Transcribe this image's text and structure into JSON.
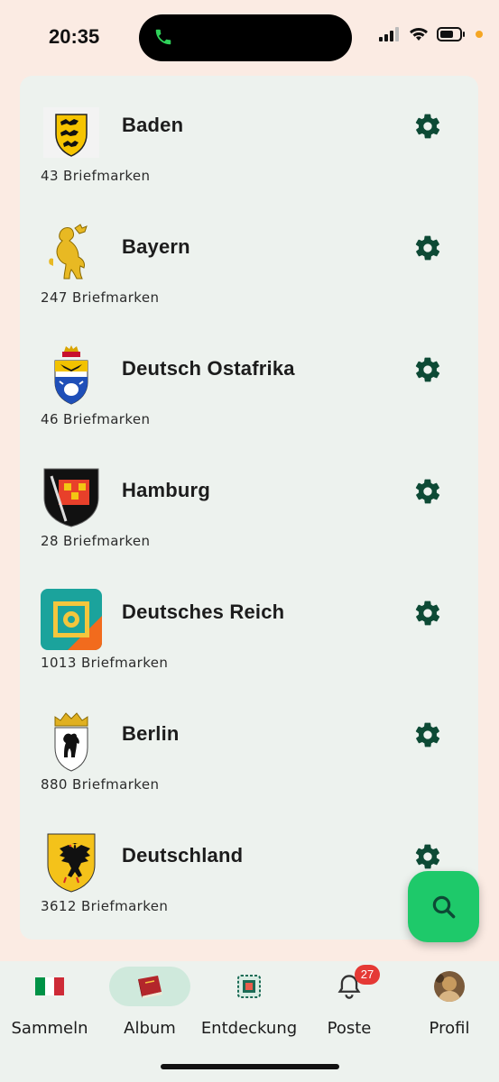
{
  "status_bar": {
    "time": "20:35"
  },
  "albums": [
    {
      "name": "Baden",
      "count": "43 Briefmarken",
      "crest": "baden-coat-of-arms-icon"
    },
    {
      "name": "Bayern",
      "count": "247 Briefmarken",
      "crest": "bavaria-lion-icon"
    },
    {
      "name": "Deutsch Ostafrika",
      "count": "46 Briefmarken",
      "crest": "east-africa-coat-of-arms-icon"
    },
    {
      "name": "Hamburg",
      "count": "28 Briefmarken",
      "crest": "hamburg-coat-of-arms-icon"
    },
    {
      "name": "Deutsches Reich",
      "count": "1013 Briefmarken",
      "crest": "stamp-icon"
    },
    {
      "name": "Berlin",
      "count": "880 Briefmarken",
      "crest": "berlin-bear-icon"
    },
    {
      "name": "Deutschland",
      "count": "3612 Briefmarken",
      "crest": "german-eagle-icon"
    }
  ],
  "nav": {
    "items": [
      {
        "label": "Sammeln",
        "icon": "italy-flag-icon"
      },
      {
        "label": "Album",
        "icon": "book-icon",
        "active": true
      },
      {
        "label": "Entdeckung",
        "icon": "stamp-frame-icon"
      },
      {
        "label": "Poste",
        "icon": "bell-icon",
        "badge": "27"
      },
      {
        "label": "Profil",
        "icon": "avatar"
      }
    ]
  },
  "colors": {
    "accent": "#1ec96a",
    "gear": "#0d4a35",
    "background": "#fbebe3",
    "card": "#edf2ee"
  }
}
